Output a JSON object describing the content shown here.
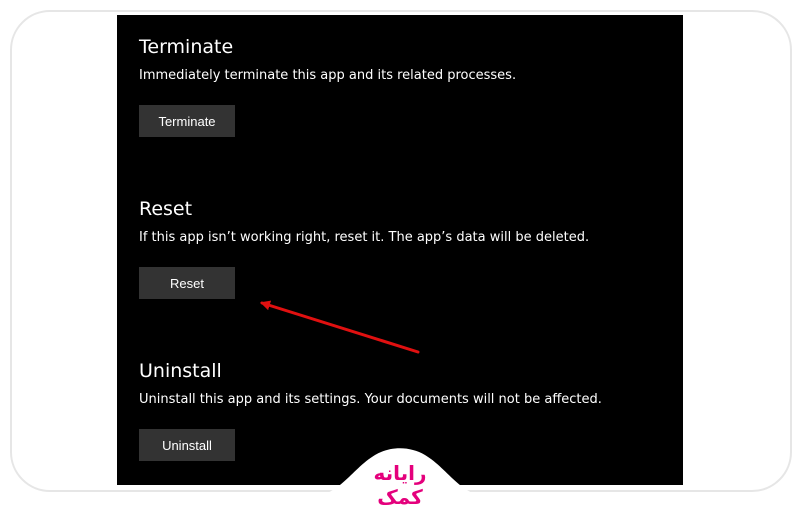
{
  "sections": [
    {
      "title": "Terminate",
      "description": "Immediately terminate this app and its related processes.",
      "button_label": "Terminate"
    },
    {
      "title": "Reset",
      "description": "If this app isn’t working right, reset it. The app’s data will be deleted.",
      "button_label": "Reset"
    },
    {
      "title": "Uninstall",
      "description": "Uninstall this app and its settings. Your documents will not be affected.",
      "button_label": "Uninstall"
    }
  ],
  "watermark": {
    "text": "رایانه کمک"
  },
  "colors": {
    "panel_bg": "#000000",
    "button_bg": "#333333",
    "arrow": "#e01010",
    "brand": "#e4007c"
  },
  "annotation": {
    "icon": "red-arrow-icon"
  }
}
